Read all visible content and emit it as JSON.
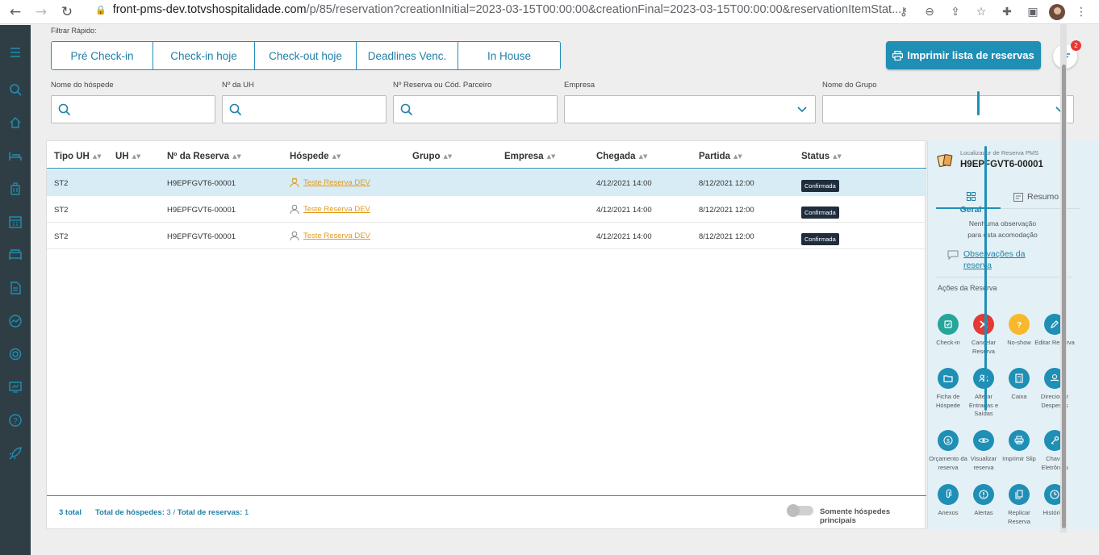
{
  "browser": {
    "url_host": "front-pms-dev.totvshospitalidade.com",
    "url_path": "/p/85/reservation?creationInitial=2023-03-15T00:00:00&creationFinal=2023-03-15T00:00:00&reservationItemStat..."
  },
  "quick_filter": {
    "label": "Filtrar Rápido:",
    "buttons": [
      "Pré Check-in",
      "Check-in hoje",
      "Check-out hoje",
      "Deadlines Venc.",
      "In House"
    ]
  },
  "print_button": "Imprimir lista de reservas",
  "filter_badge": "2",
  "filters": {
    "guest_name": "Nome do hóspede",
    "uh_number": "Nº da UH",
    "reservation_number": "Nº Reserva ou Cód. Parceiro",
    "company": "Empresa",
    "group_name": "Nome do Grupo"
  },
  "table": {
    "headers": [
      "Tipo UH",
      "UH",
      "Nº da Reserva",
      "Hóspede",
      "Grupo",
      "Empresa",
      "Chegada",
      "Partida",
      "Status"
    ],
    "rows": [
      {
        "tipo_uh": "ST2",
        "uh": "",
        "reserva": "H9EPFGVT6-00001",
        "hospede": "Teste Reserva DEV",
        "chegada": "4/12/2021 14:00",
        "partida": "8/12/2021 12:00",
        "status": "Confirmada"
      },
      {
        "tipo_uh": "ST2",
        "uh": "",
        "reserva": "H9EPFGVT6-00001",
        "hospede": "Teste Reserva DEV",
        "chegada": "4/12/2021 14:00",
        "partida": "8/12/2021 12:00",
        "status": "Confirmada"
      },
      {
        "tipo_uh": "ST2",
        "uh": "",
        "reserva": "H9EPFGVT6-00001",
        "hospede": "Teste Reserva DEV",
        "chegada": "4/12/2021 14:00",
        "partida": "8/12/2021 12:00",
        "status": "Confirmada"
      }
    ]
  },
  "footer": {
    "total": "3 total",
    "guests_label": "Total de hóspedes:",
    "guests_value": "3",
    "separator": "/",
    "reservations_label": "Total de reservas:",
    "reservations_value": "1",
    "toggle_label": "Somente hóspedes principais"
  },
  "panel": {
    "locator_label": "Localizador de Reserva PMS",
    "locator_code": "H9EPFGVT6-00001",
    "tab_general": "Geral",
    "tab_summary": "Resumo",
    "no_obs_line1": "Nenhuma observação",
    "no_obs_line2": "para esta acomodação",
    "obs_link": "Observações da reserva",
    "actions_title": "Ações da Reserva",
    "actions": [
      {
        "label": "Check-in",
        "color": "#26a69a"
      },
      {
        "label": "Cancelar Reserva",
        "color": "#e53935"
      },
      {
        "label": "No-show",
        "color": "#f9b82b"
      },
      {
        "label": "Editar Reserva",
        "color": "#1f8fb5"
      },
      {
        "label": "Ficha de Hóspede",
        "color": "#1f8fb5"
      },
      {
        "label": "Alterar Entradas e Saídas",
        "color": "#1f8fb5"
      },
      {
        "label": "Caixa",
        "color": "#1f8fb5"
      },
      {
        "label": "Direcionar Despesas",
        "color": "#1f8fb5"
      },
      {
        "label": "Orçamento da reserva",
        "color": "#1f8fb5"
      },
      {
        "label": "Visualizar reserva",
        "color": "#1f8fb5"
      },
      {
        "label": "Imprimir Slip",
        "color": "#1f8fb5"
      },
      {
        "label": "Chave Eletrônica",
        "color": "#1f8fb5"
      },
      {
        "label": "Anexos",
        "color": "#1f8fb5"
      },
      {
        "label": "Alertas",
        "color": "#1f8fb5"
      },
      {
        "label": "Replicar Reserva",
        "color": "#1f8fb5"
      },
      {
        "label": "Histórico",
        "color": "#1f8fb5"
      }
    ]
  },
  "colors": {
    "accent": "#1f8fb5",
    "sidebar": "#2f3e45",
    "guest_link": "#e39a1b",
    "status_bg": "#1f2d3d"
  }
}
